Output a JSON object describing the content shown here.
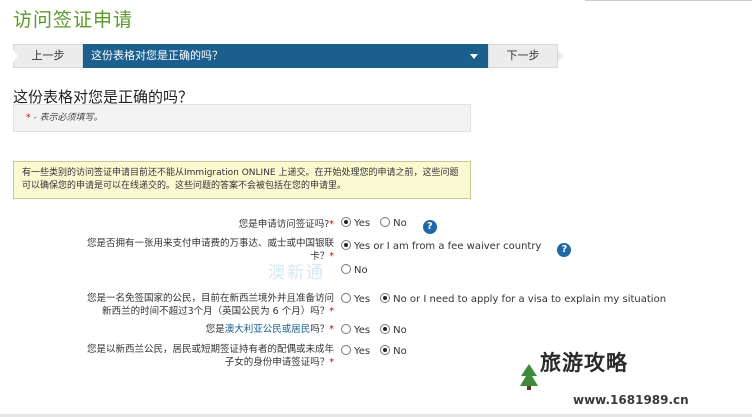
{
  "page": {
    "title": "访问签证申请"
  },
  "nav": {
    "prev_label": "上一步",
    "current_page": "这份表格对您是正确的吗？",
    "next_label": "下一步"
  },
  "heading": "这份表格对您是正确的吗？",
  "required_note": {
    "star": "*",
    "text": " - 表示必须填写。"
  },
  "info_text": "有一些类别的访问签证申请目前还不能从Immigration ONLINE 上递交。在开始处理您的申请之前，这些问题可以确保您的申请是可以在线递交的。这些问题的答案不会被包括在您的申请里。",
  "questions": [
    {
      "label": "您是申请访问签证吗?",
      "star": "*",
      "options": [
        "Yes",
        "No"
      ],
      "selected": 0,
      "help": "?"
    },
    {
      "label": "您是否拥有一张用来支付申请费的万事达、威士或中国银联卡？",
      "star": "*",
      "options": [
        "Yes or I am from a fee waiver country",
        "No"
      ],
      "selected": 0,
      "help": "?"
    },
    {
      "label": "您是一名免签国家的公民，目前在新西兰境外并且准备访问新西兰的时间不超过3个月（英国公民为 6 个月）吗？",
      "star": "*",
      "options": [
        "Yes",
        "No or I need to apply for a visa to explain my situation"
      ],
      "selected": 1
    },
    {
      "label_pre": "您是",
      "label_link": "澳大利亚公民或居民",
      "label_post": "吗？",
      "star": "*",
      "options": [
        "Yes",
        "No"
      ],
      "selected": 1
    },
    {
      "label": "您是以新西兰公民，居民或短期签证持有者的配偶或未成年子女的身份申请签证吗？",
      "star": "*",
      "options": [
        "Yes",
        "No"
      ],
      "selected": 1
    }
  ],
  "watermarks": {
    "center": "澳新通",
    "brand": "旅游攻略",
    "url": "www.1681989.cn"
  },
  "colors": {
    "title_green": "#5a9a2a",
    "nav_blue": "#1a5f8e",
    "info_bg": "#fbf9d2",
    "required_red": "#cc0000"
  }
}
